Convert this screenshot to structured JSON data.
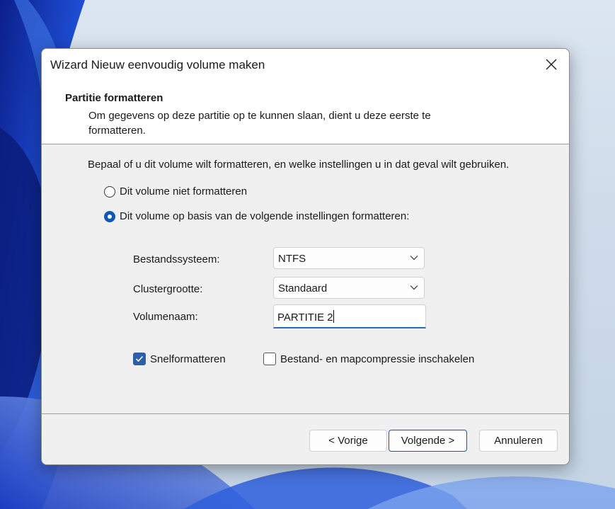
{
  "dialog": {
    "title": "Wizard Nieuw eenvoudig volume maken",
    "header": {
      "title": "Partitie formatteren",
      "description": "Om gegevens op deze partitie op te kunnen slaan, dient u deze eerste te formatteren."
    },
    "intro": "Bepaal of u dit volume wilt formatteren, en welke instellingen u in dat geval wilt gebruiken.",
    "options": {
      "no_format": {
        "label": "Dit volume niet formatteren",
        "selected": false
      },
      "format": {
        "label": "Dit volume op basis van de volgende instellingen formatteren:",
        "selected": true
      }
    },
    "fields": {
      "filesystem": {
        "label": "Bestandssysteem:",
        "value": "NTFS"
      },
      "cluster_size": {
        "label": "Clustergrootte:",
        "value": "Standaard"
      },
      "volume_name": {
        "label": "Volumenaam:",
        "value": "PARTITIE 2"
      }
    },
    "checkboxes": {
      "quick_format": {
        "label": "Snelformatteren",
        "checked": true
      },
      "compression": {
        "label": "Bestand- en mapcompressie inschakelen",
        "checked": false
      }
    },
    "buttons": {
      "back": "< Vorige",
      "next": "Volgende >",
      "cancel": "Annuleren"
    }
  },
  "colors": {
    "accent": "#0f57b5",
    "checkbox_fill": "#2b5fa6",
    "dialog_bg": "#f0f0f0"
  },
  "icons": {
    "close": "close-icon",
    "chevron": "chevron-down-icon",
    "check": "checkmark-icon"
  }
}
